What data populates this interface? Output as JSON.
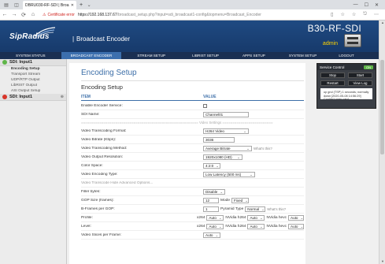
{
  "browser": {
    "tab_title": "DBRU030-RF-SDI | Broa",
    "url_host": "https://192.168.137.67",
    "url_path": "/broadcast_setup.php?input=sdi_broadcast1-config&topmenu=Broadcast_Encoder",
    "cert_warning": "Certificate error"
  },
  "header": {
    "logo": "SipRadius",
    "separator": "|",
    "app_title": "Broadcast Encoder",
    "device_name": "B30-RF-SDI",
    "user": "admin"
  },
  "menu": {
    "items": [
      {
        "label": "SYSTEM STATUS",
        "active": false
      },
      {
        "label": "BROADCAST ENCODER",
        "active": true
      },
      {
        "label": "STREAM SETUP",
        "active": false
      },
      {
        "label": "LIBRIST SETUP",
        "active": false
      },
      {
        "label": "APPS SETUP",
        "active": false
      },
      {
        "label": "SYSTEM SETUP",
        "active": false
      },
      {
        "label": "LOGOUT",
        "active": false
      }
    ]
  },
  "sidebar": {
    "input1": "SDI: Input1",
    "input2": "SDI: Input1",
    "input1_color": "#5fb548",
    "input2_color": "#d8352a",
    "items": [
      {
        "label": "Encoding Setup",
        "active": true
      },
      {
        "label": "Transport Stream",
        "active": false
      },
      {
        "label": "UDP/RTP Output",
        "active": false
      },
      {
        "label": "LibRIST Output",
        "active": false
      },
      {
        "label": "ASI Output Setup",
        "active": false
      }
    ]
  },
  "main": {
    "page_title": "Encoding Setup",
    "section_title": "Encoding Setup",
    "col_item": "ITEM",
    "col_value": "VALUE",
    "enable_label": "Enable Encoder Service:",
    "sdi_name_label": "SDI Name:",
    "sdi_name_value": "Channel01",
    "sep_left": "=================================",
    "sep_right": "========================= Video Settings =========================",
    "rows": {
      "transcoding_format": {
        "label": "Video Transcoding Format:",
        "value": "H264 Video"
      },
      "bitrate": {
        "label": "Video Bitrate (Kbps):",
        "value": "3036"
      },
      "method": {
        "label": "Video Transcoding Method:",
        "value": "Average Bitrate",
        "hint": "What's this?"
      },
      "resolution": {
        "label": "Video Output Resolution:",
        "value": "1920x1080 (HD)"
      },
      "color_space": {
        "label": "Color Space:",
        "value": "4:2:0"
      },
      "encoding_type": {
        "label": "Video Encoding Type:",
        "value": "Low Latency (500 ms)"
      },
      "hide_advanced": {
        "label": "Video Transcode Hide Advanced Options..."
      },
      "filler": {
        "label": "Filler bytes:",
        "value": "Disable"
      },
      "gop": {
        "label": "GOP Size (frames):",
        "value": "12",
        "mode_label": "Mode",
        "mode_value": "Fixed"
      },
      "bframes": {
        "label": "B-Frames per GOP:",
        "value": "1",
        "pyramid_label": "Pyramid Type",
        "pyramid_value": "Normal",
        "hint": "What's this?"
      },
      "profile": {
        "label": "Profile:",
        "x264": "x264",
        "x264_val": "Auto",
        "nv": "NVidia h264",
        "nv_val": "Auto",
        "nvh": "NVidia hevc",
        "nvh_val": "Auto"
      },
      "level": {
        "label": "Level:",
        "x264": "x264",
        "x264_val": "Auto",
        "nv": "NVidia h264",
        "nv_val": "Auto",
        "nvh": "NVidia hevc",
        "nvh_val": "Auto"
      },
      "slices": {
        "label": "Video Slices per Frame:",
        "value": "Auto"
      }
    }
  },
  "service_panel": {
    "title": "Service Control",
    "state": "ON",
    "stop": "Stop",
    "start": "Start",
    "restart": "Restart",
    "view_log": "View Log",
    "status": "up gnd (TSP) 1 seconds; normally down [2020-05-08 14:56:29] Couldn't open card"
  }
}
